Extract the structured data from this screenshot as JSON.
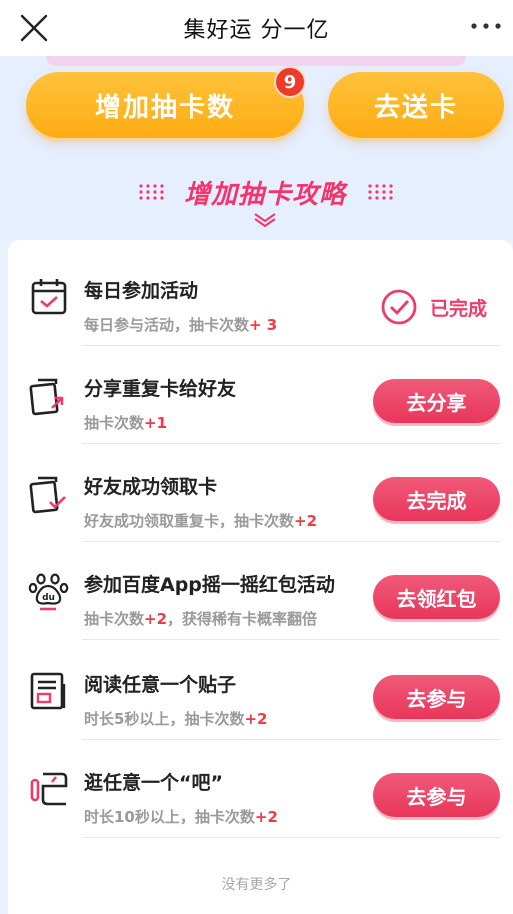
{
  "navbar": {
    "title": "集好运 分一亿"
  },
  "top": {
    "draw_button": "增加抽卡数",
    "draw_badge": "9",
    "send_button": "去送卡"
  },
  "strategy": {
    "heading": "增加抽卡攻略"
  },
  "tasks": [
    {
      "title": "每日参加活动",
      "subtitle": "每日参与活动，抽卡次数",
      "bonus": "+ 3",
      "status": "已完成",
      "icon": "calendar-check-icon"
    },
    {
      "title": "分享重复卡给好友",
      "subtitle": "抽卡次数",
      "bonus": "+1",
      "action": "去分享",
      "icon": "share-card-icon"
    },
    {
      "title": "好友成功领取卡",
      "subtitle": "好友成功领取重复卡，抽卡次数",
      "bonus": "+2",
      "action": "去完成",
      "icon": "card-check-icon"
    },
    {
      "title": "参加百度App摇一摇红包活动",
      "subtitle_pre": "抽卡次数",
      "bonus": "+2",
      "subtitle_post": "，获得稀有卡概率翻倍",
      "action": "去领红包",
      "icon": "baidu-paw-icon"
    },
    {
      "title": "阅读任意一个贴子",
      "subtitle": "时长5秒以上，抽卡次数",
      "bonus": "+2",
      "action": "去参与",
      "icon": "article-icon"
    },
    {
      "title": "逛任意一个“吧”",
      "subtitle": "时长10秒以上，抽卡次数",
      "bonus": "+2",
      "action": "去参与",
      "icon": "tieba-icon"
    }
  ],
  "footer": {
    "note": "没有更多了"
  },
  "colors": {
    "accent_pink": "#e8365a",
    "accent_orange": "#ffac14",
    "bonus_red": "#f13a48",
    "background": "#eaf2ff"
  }
}
